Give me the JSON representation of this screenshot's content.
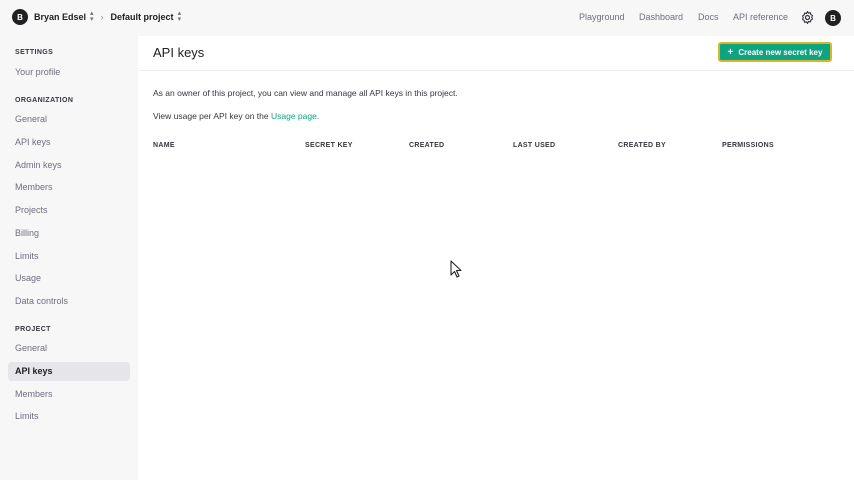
{
  "topbar": {
    "org_initial": "B",
    "org_name": "Bryan Edsel",
    "separator": "›",
    "project_name": "Default project",
    "nav": [
      "Playground",
      "Dashboard",
      "Docs",
      "API reference"
    ],
    "user_initial": "B"
  },
  "sidebar": {
    "settings_heading": "SETTINGS",
    "settings_items": [
      "Your profile"
    ],
    "organization_heading": "ORGANIZATION",
    "organization_items": [
      "General",
      "API keys",
      "Admin keys",
      "Members",
      "Projects",
      "Billing",
      "Limits",
      "Usage",
      "Data controls"
    ],
    "project_heading": "PROJECT",
    "project_items": [
      "General",
      "API keys",
      "Members",
      "Limits"
    ],
    "active_item": "API keys"
  },
  "main": {
    "title": "API keys",
    "create_button": "Create new secret key",
    "description": "As an owner of this project, you can view and manage all API keys in this project.",
    "usage_prefix": "View usage per API key on the ",
    "usage_link": "Usage page",
    "usage_suffix": ".",
    "table_headers": [
      "NAME",
      "SECRET KEY",
      "CREATED",
      "LAST USED",
      "CREATED BY",
      "PERMISSIONS"
    ]
  },
  "colors": {
    "accent": "#10a37f",
    "button_outline": "#d4b82a",
    "sidebar_bg": "#f7f7f8",
    "active_bg": "#e6e6ea"
  }
}
